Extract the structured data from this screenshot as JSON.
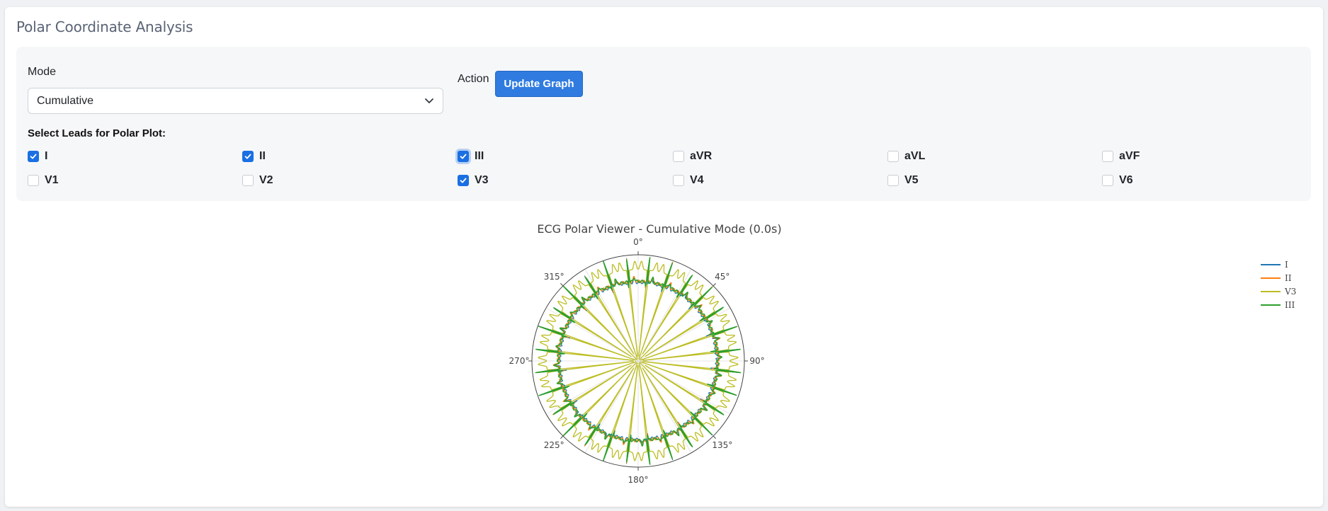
{
  "title": "Polar Coordinate Analysis",
  "controls": {
    "mode_label": "Mode",
    "mode_value": "Cumulative",
    "action_label": "Action",
    "update_button": "Update Graph",
    "leads_heading": "Select Leads for Polar Plot:"
  },
  "leads": [
    {
      "label": "I",
      "checked": true
    },
    {
      "label": "II",
      "checked": true
    },
    {
      "label": "III",
      "checked": true
    },
    {
      "label": "aVR",
      "checked": false
    },
    {
      "label": "aVL",
      "checked": false
    },
    {
      "label": "aVF",
      "checked": false
    },
    {
      "label": "V1",
      "checked": false
    },
    {
      "label": "V2",
      "checked": false
    },
    {
      "label": "V3",
      "checked": true
    },
    {
      "label": "V4",
      "checked": false
    },
    {
      "label": "V5",
      "checked": false
    },
    {
      "label": "V6",
      "checked": false
    }
  ],
  "colors": {
    "accent": "#2f7be0",
    "checkbox": "#1a6fe3"
  },
  "chart_data": {
    "type": "polar-line",
    "title": "ECG Polar Viewer - Cumulative Mode (0.0s)",
    "angular_ticks": [
      "0°",
      "45°",
      "90°",
      "135°",
      "180°",
      "225°",
      "270°",
      "315°"
    ],
    "direction": "clockwise",
    "rotation": "0° at top",
    "legend_position": "top-right",
    "series": [
      {
        "name": "I",
        "color": "#1f77b4",
        "base_r": 0.74,
        "spike_r": 0.98,
        "spikes": 28
      },
      {
        "name": "II",
        "color": "#ff7f0e",
        "base_r": 0.75,
        "spike_r": 0.98,
        "spikes": 28
      },
      {
        "name": "V3",
        "color": "#bcbd22",
        "base_r": 0.86,
        "spike_r": 0.0,
        "spikes": 28
      },
      {
        "name": "III",
        "color": "#2ca02c",
        "base_r": 0.75,
        "spike_r": 0.99,
        "spikes": 28
      }
    ]
  }
}
